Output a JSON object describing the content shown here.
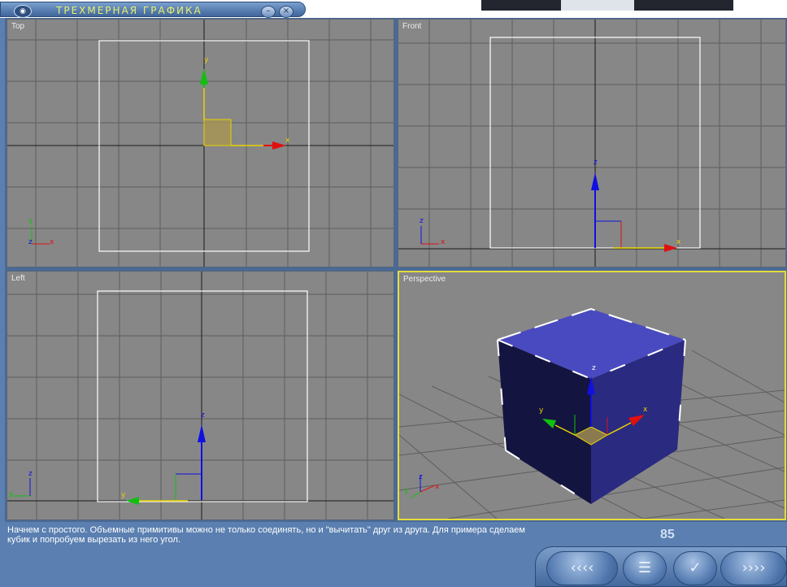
{
  "window": {
    "title": "ТРЕХМЕРНАЯ ГРАФИКА",
    "minimize_glyph": "–",
    "close_glyph": "×"
  },
  "viewports": {
    "top": {
      "label": "Top"
    },
    "front": {
      "label": "Front"
    },
    "left": {
      "label": "Left"
    },
    "perspective": {
      "label": "Perspective",
      "active": true
    }
  },
  "axes": {
    "x": "x",
    "y": "y",
    "z": "z"
  },
  "description": "Начнем с простого. Объемные примитивы можно не только соединять, но и \"вычитать\" друг из друга. Для примера сделаем кубик и попробуем вырезать из него угол.",
  "page_number": "85",
  "navigation": {
    "first_glyph": "‹‹‹‹",
    "menu_glyph": "☰",
    "check_glyph": "✓",
    "next_glyph": "››››"
  },
  "colors": {
    "viewport_bg": "#878787",
    "active_border": "#e6dc3e",
    "cube_blue": "#4a4ac0",
    "axis_x": "#e01010",
    "axis_y": "#10c010",
    "axis_z": "#1010e0"
  },
  "icons": [
    "app-icon",
    "minimize-icon",
    "close-icon",
    "rewind-icon",
    "menu-icon",
    "checkmark-icon",
    "forward-icon"
  ]
}
